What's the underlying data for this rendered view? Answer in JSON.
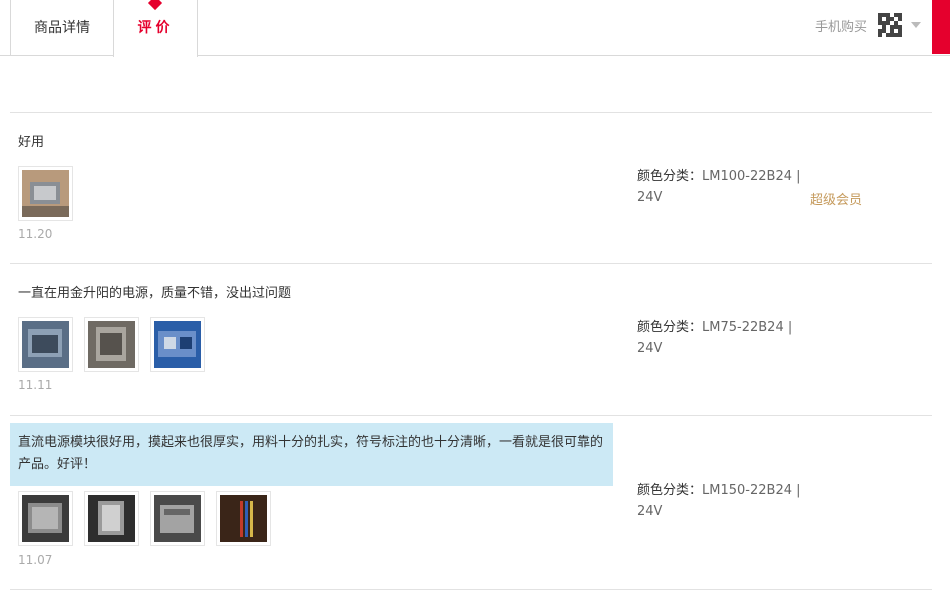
{
  "tabs": {
    "detail_label": "商品详情",
    "review_label": "评价"
  },
  "mobile_buy_label": "手机购买",
  "colors": {
    "accent": "#e5002d",
    "highlight": "#cce9f5",
    "member": "#c59a5c"
  },
  "reviews": [
    {
      "text": "好用",
      "date": "11.20",
      "sku_key": "颜色分类：",
      "sku_value": "LM100-22B24 | 24V",
      "member_badge": "超级会员",
      "photos": [
        "photo-1"
      ]
    },
    {
      "text": "一直在用金升阳的电源，质量不错，没出过问题",
      "date": "11.11",
      "sku_key": "颜色分类：",
      "sku_value": "LM75-22B24 | 24V",
      "photos": [
        "photo-1",
        "photo-2",
        "photo-3"
      ]
    },
    {
      "text": "直流电源模块很好用，摸起来也很厚实，用料十分的扎实，符号标注的也十分清晰，一看就是很可靠的产品。好评！",
      "date": "11.07",
      "sku_key": "颜色分类：",
      "sku_value": "LM150-22B24 | 24V",
      "photos": [
        "photo-1",
        "photo-2",
        "photo-3",
        "photo-4"
      ]
    }
  ]
}
